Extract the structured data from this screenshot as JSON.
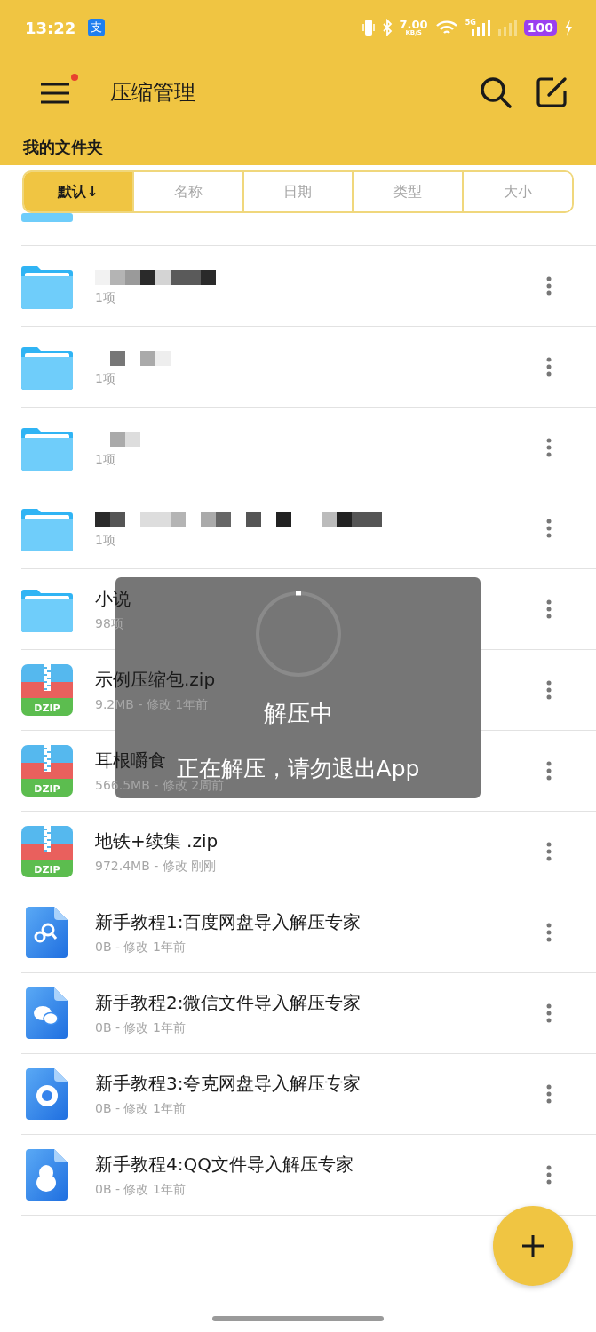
{
  "status_bar": {
    "time": "13:22",
    "app_badge": "支",
    "speed": "7.00",
    "speed_unit": "KB/S",
    "network": "5G",
    "battery": "100"
  },
  "app_bar": {
    "title": "压缩管理",
    "menu_dot": true
  },
  "section_title": "我的文件夹",
  "sort_tabs": [
    {
      "label": "默认↓",
      "selected": true
    },
    {
      "label": "名称",
      "selected": false
    },
    {
      "label": "日期",
      "selected": false
    },
    {
      "label": "类型",
      "selected": false
    },
    {
      "label": "大小",
      "selected": false
    }
  ],
  "files": [
    {
      "kind": "folder",
      "redacted": true,
      "meta": "1项"
    },
    {
      "kind": "folder",
      "redacted": true,
      "meta": "1项"
    },
    {
      "kind": "folder",
      "redacted": true,
      "meta": "1项"
    },
    {
      "kind": "folder",
      "redacted": true,
      "meta": "1项"
    },
    {
      "kind": "folder",
      "name": "小说",
      "meta": "98项"
    },
    {
      "kind": "archive",
      "name": "示例压缩包.zip",
      "meta": "9.2MB - 修改 1年前",
      "badge": "DZIP"
    },
    {
      "kind": "archive",
      "name": "耳根嚼食",
      "meta": "566.5MB - 修改 2周前",
      "badge": "DZIP"
    },
    {
      "kind": "archive",
      "name": "地铁+续集 .zip",
      "meta": "972.4MB - 修改 刚刚",
      "badge": "DZIP"
    },
    {
      "kind": "cloud",
      "name": "新手教程1:百度网盘导入解压专家",
      "meta": "0B - 修改 1年前"
    },
    {
      "kind": "chat",
      "name": "新手教程2:微信文件导入解压专家",
      "meta": "0B - 修改 1年前"
    },
    {
      "kind": "ring",
      "name": "新手教程3:夸克网盘导入解压专家",
      "meta": "0B - 修改 1年前"
    },
    {
      "kind": "penguin",
      "name": "新手教程4:QQ文件导入解压专家",
      "meta": "0B - 修改 1年前"
    }
  ],
  "dialog": {
    "title": "解压中",
    "message": "正在解压，请勿退出App"
  }
}
